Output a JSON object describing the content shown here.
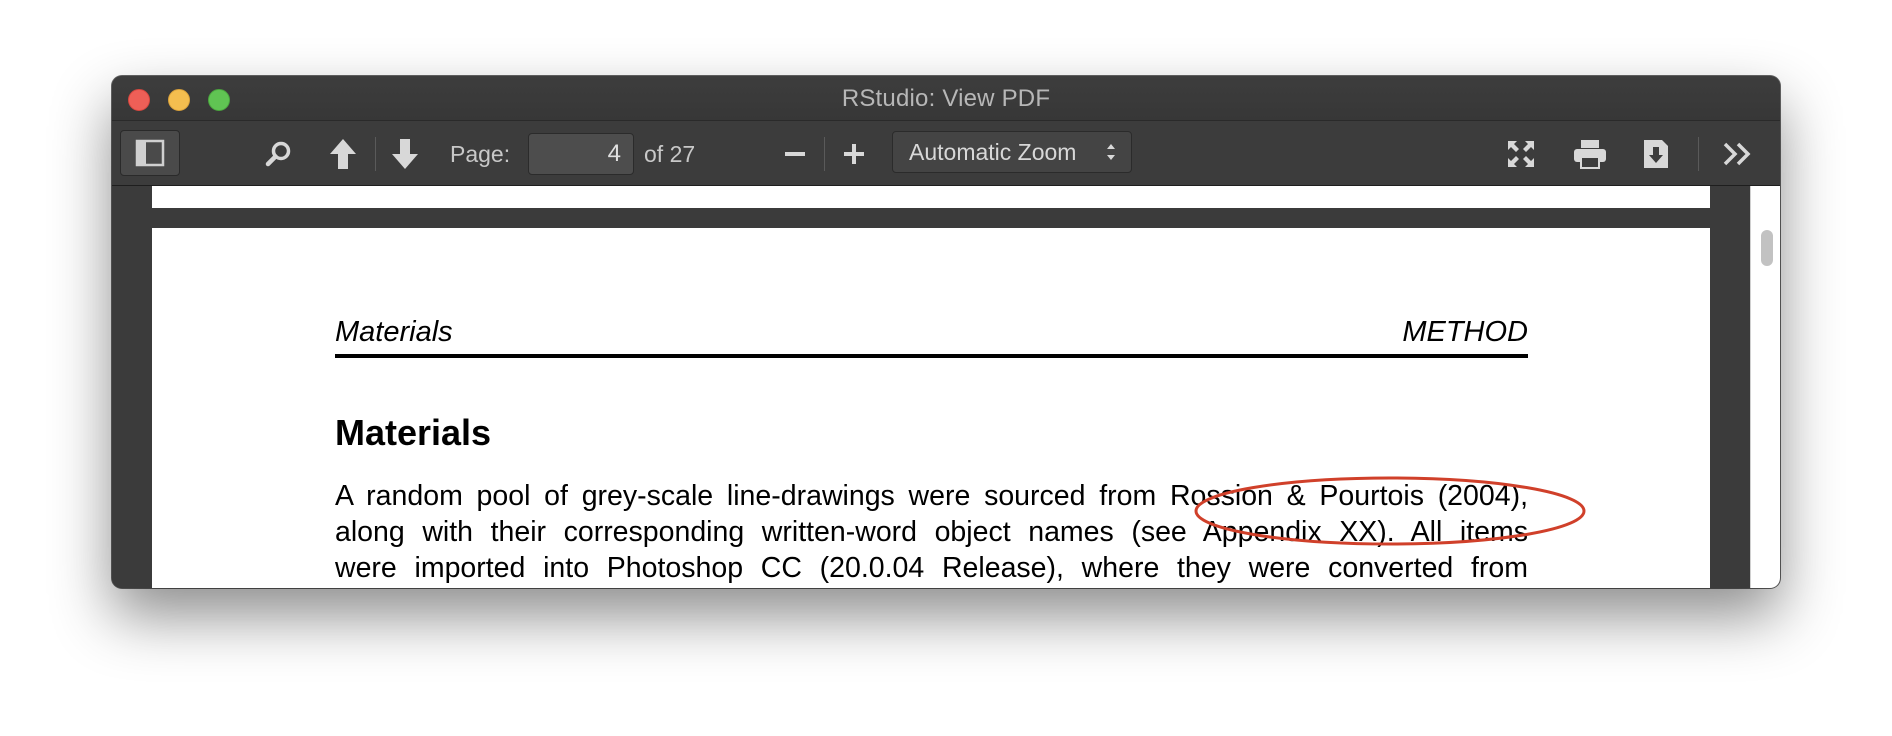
{
  "window": {
    "title": "RStudio: View PDF"
  },
  "toolbar": {
    "page_label": "Page:",
    "page_value": "4",
    "page_total": "of 27",
    "zoom_selected": "Automatic Zoom",
    "icons": [
      "sidebar-toggle-icon",
      "search-icon",
      "previous-page-icon",
      "next-page-icon",
      "zoom-out-icon",
      "zoom-in-icon",
      "fullscreen-icon",
      "print-icon",
      "download-icon",
      "more-tools-icon"
    ]
  },
  "document": {
    "header_left": "Materials",
    "header_right": "METHOD",
    "section_title": "Materials",
    "lines": [
      "A random pool of grey-scale line-drawings were sourced from Rossion & Pourtois (2004),",
      "along with their corresponding written-word object names (see Appendix XX). All items",
      "were imported into Photoshop CC (20.0.04 Release), where they were converted from"
    ]
  },
  "colors": {
    "annotation": "#d0402a",
    "titlebar": "#3a3a3a",
    "toolbar": "#3c3c3c",
    "page": "#ffffff"
  }
}
